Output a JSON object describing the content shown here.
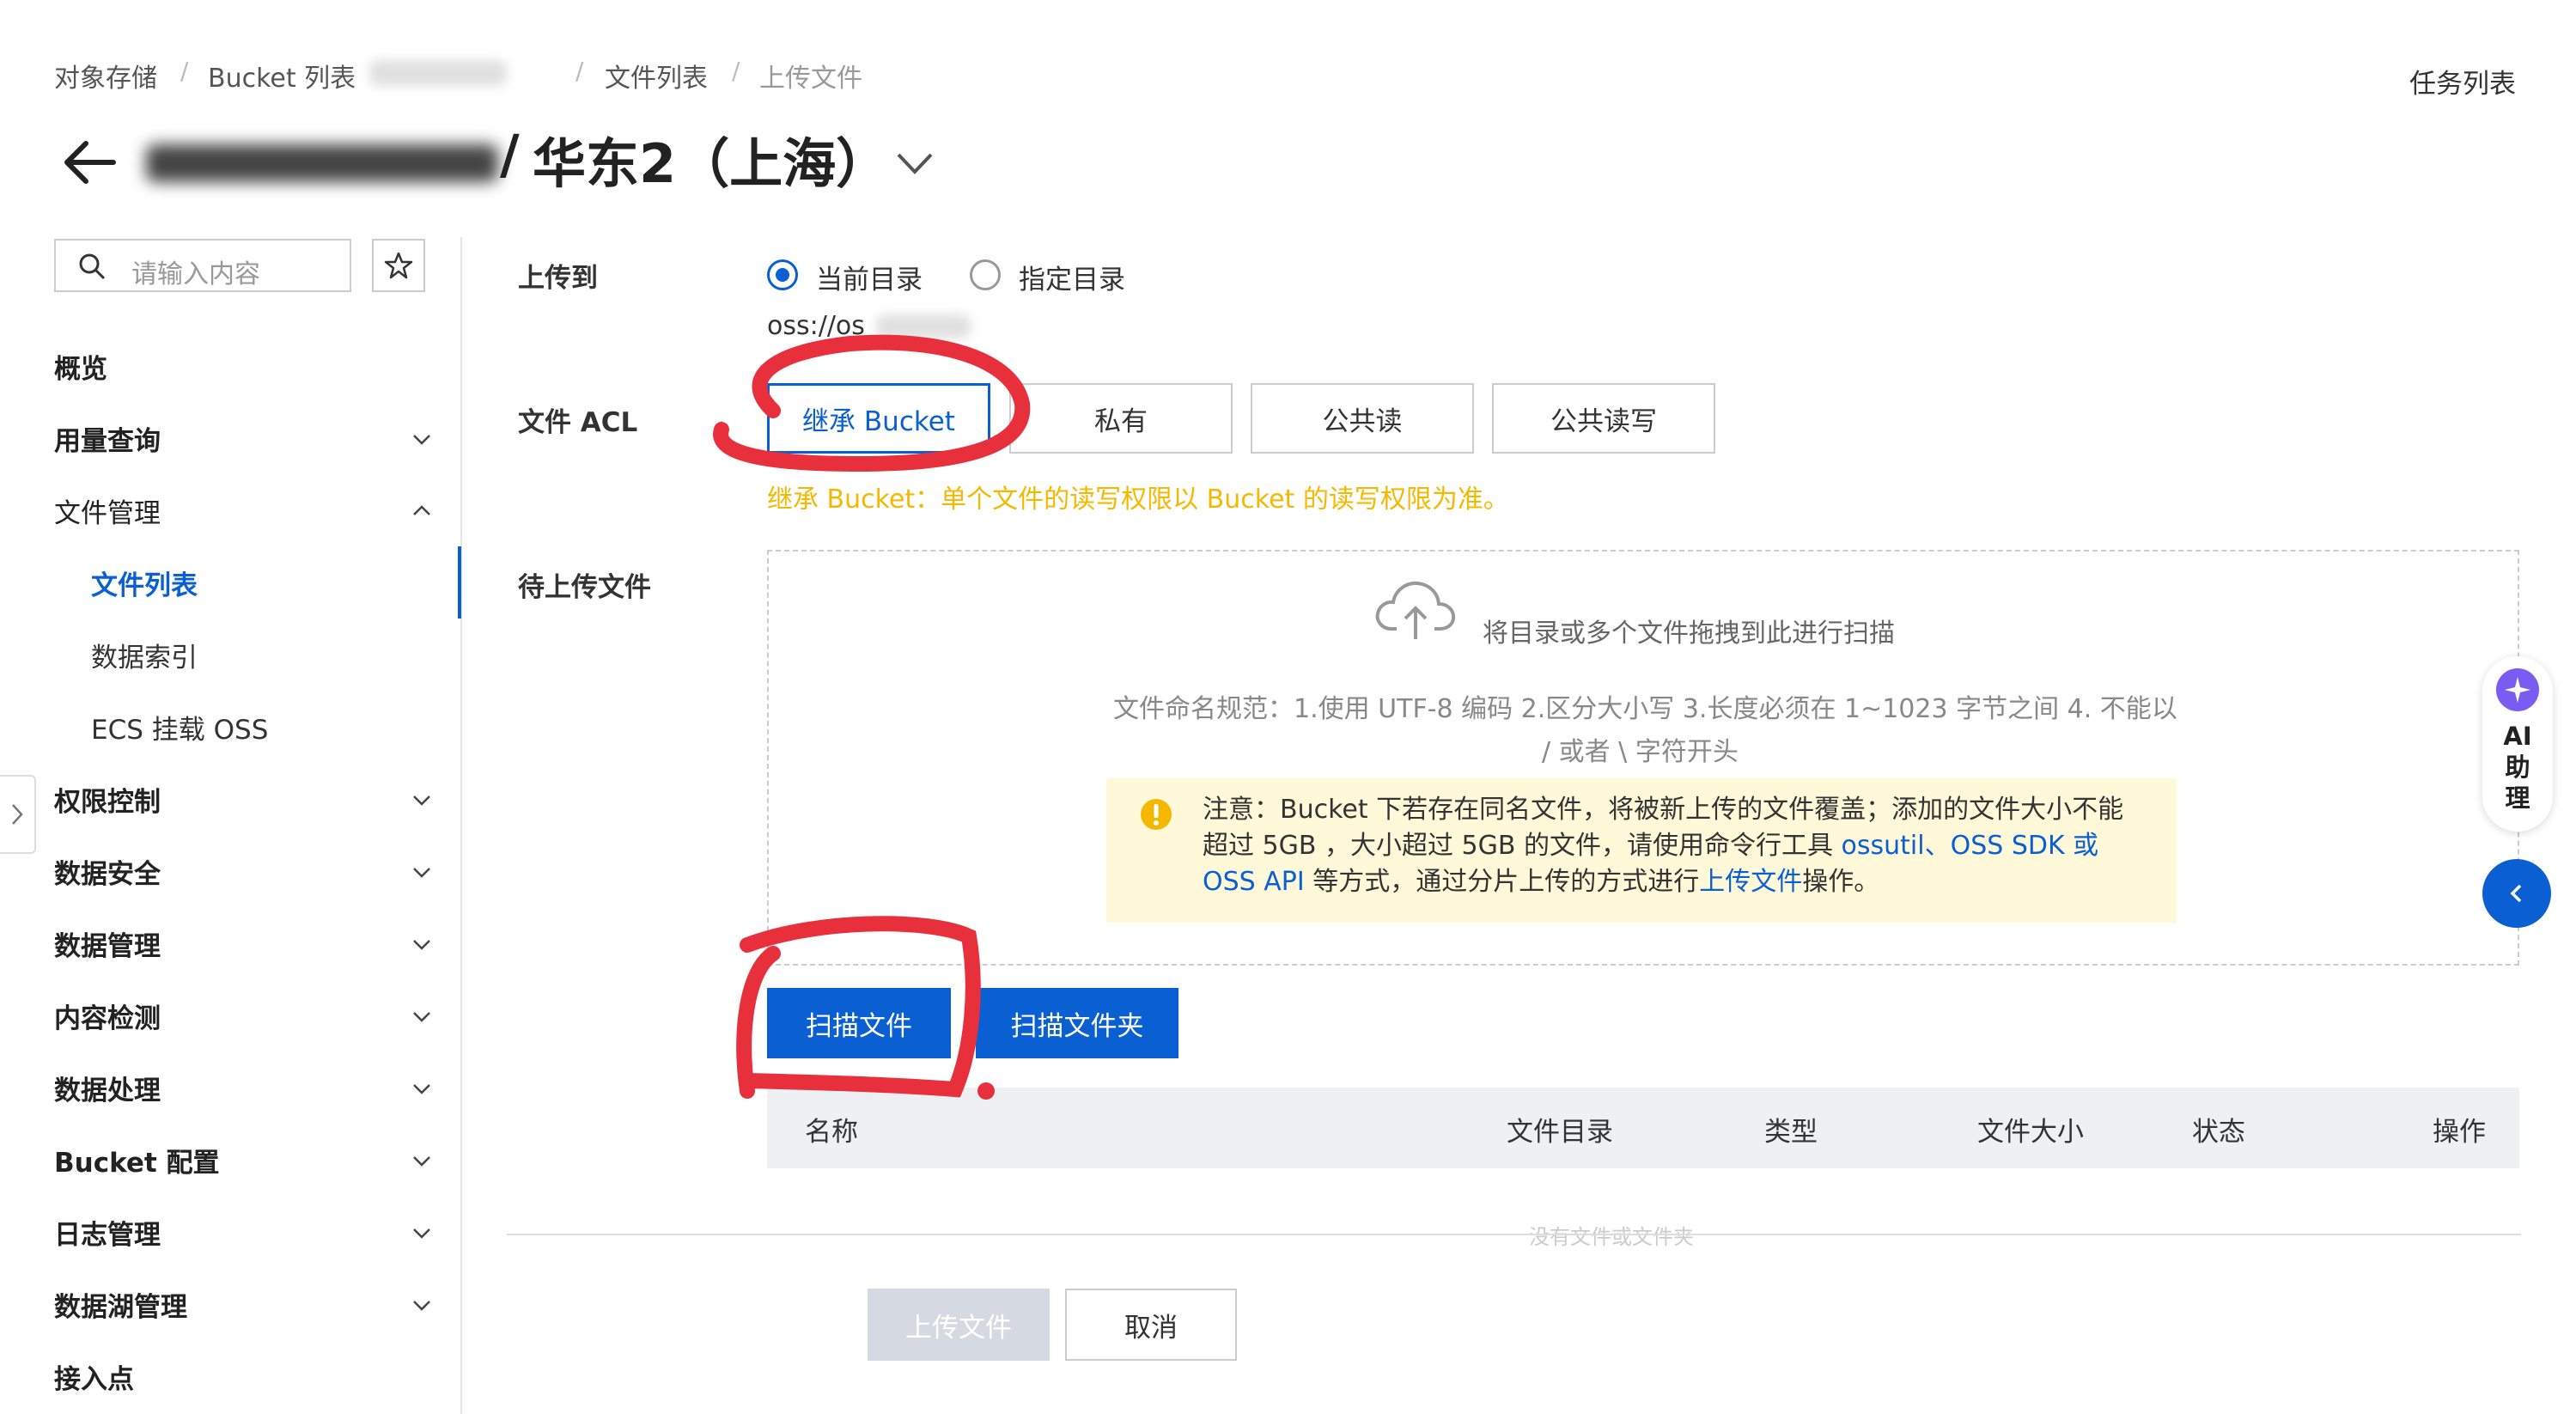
{
  "breadcrumb": {
    "items": [
      "对象存储",
      "Bucket 列表",
      "文件列表",
      "上传文件"
    ],
    "separator": "/"
  },
  "header": {
    "title_suffix": "华东2（上海）",
    "task_list": "任务列表"
  },
  "sidebar": {
    "search_placeholder": "请输入内容",
    "items": [
      {
        "label": "概览"
      },
      {
        "label": "用量查询"
      },
      {
        "label": "文件管理"
      },
      {
        "label": "文件列表"
      },
      {
        "label": "数据索引"
      },
      {
        "label": "ECS 挂载 OSS"
      },
      {
        "label": "权限控制"
      },
      {
        "label": "数据安全"
      },
      {
        "label": "数据管理"
      },
      {
        "label": "内容检测"
      },
      {
        "label": "数据处理"
      },
      {
        "label": "Bucket 配置"
      },
      {
        "label": "日志管理"
      },
      {
        "label": "数据湖管理"
      },
      {
        "label": "接入点"
      }
    ]
  },
  "form": {
    "upload_to_label": "上传到",
    "radio_current": "当前目录",
    "radio_specified": "指定目录",
    "oss_path": "oss://os",
    "acl_label": "文件 ACL",
    "acl_options": [
      "继承 Bucket",
      "私有",
      "公共读",
      "公共读写"
    ],
    "acl_selected": "继承 Bucket",
    "acl_hint": "继承 Bucket：单个文件的读写权限以 Bucket 的读写权限为准。",
    "pending_label": "待上传文件"
  },
  "dropzone": {
    "drag_text": "将目录或多个文件拖拽到此进行扫描",
    "rules_line1": "文件命名规范：1.使用 UTF-8 编码 2.区分大小写 3.长度必须在 1~1023 字节之间 4. 不能以",
    "rules_line2": "/ 或者 \\ 字符开头",
    "notice_part1": "注意：Bucket 下若存在同名文件，将被新上传的文件覆盖；添加的文件大小不能超过 5GB ，大小超过 5GB 的文件，请使用命令行工具 ",
    "notice_link1": "ossutil",
    "notice_sep": "、",
    "notice_link2": "OSS SDK 或 OSS API",
    "notice_part2": " 等方式，通过分片上传的方式进行",
    "notice_link3": "上传文件",
    "notice_part3": "操作。"
  },
  "buttons": {
    "scan_files": "扫描文件",
    "scan_folder": "扫描文件夹",
    "upload": "上传文件",
    "cancel": "取消"
  },
  "table": {
    "columns": [
      "名称",
      "文件目录",
      "类型",
      "文件大小",
      "状态",
      "操作"
    ]
  },
  "empty_text": "没有文件或文件夹",
  "ai_assistant": {
    "chars": [
      "AI",
      "助",
      "理"
    ]
  },
  "colors": {
    "primary": "#0a5fd2",
    "hint_yellow": "#f5b800",
    "notice_bg": "#fff8d9",
    "annotation_red": "#e8303c"
  }
}
